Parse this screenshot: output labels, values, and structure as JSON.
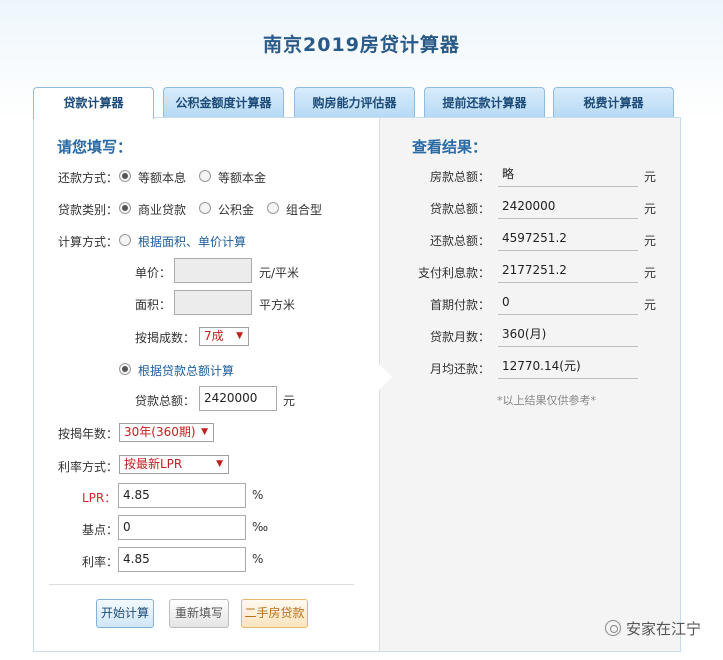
{
  "page": {
    "title": "南京2019房贷计算器"
  },
  "tabs": [
    {
      "label": "贷款计算器",
      "active": true
    },
    {
      "label": "公积金额度计算器"
    },
    {
      "label": "购房能力评估器"
    },
    {
      "label": "提前还款计算器"
    },
    {
      "label": "税费计算器"
    }
  ],
  "form": {
    "heading": "请您填写：",
    "repay_method": {
      "label": "还款方式：",
      "options": [
        "等额本息",
        "等额本金"
      ],
      "selected": "等额本息"
    },
    "loan_type": {
      "label": "贷款类别：",
      "options": [
        "商业贷款",
        "公积金",
        "组合型"
      ],
      "selected": "商业贷款"
    },
    "calc_method": {
      "label": "计算方式：",
      "option_area": "根据面积、单价计算",
      "option_total": "根据贷款总额计算",
      "selected": "根据贷款总额计算"
    },
    "unit_price": {
      "label": "单价：",
      "value": "",
      "unit": "元/平米"
    },
    "area": {
      "label": "面积：",
      "value": "",
      "unit": "平方米"
    },
    "mortgage_ratio": {
      "label": "按揭成数：",
      "value": "7成"
    },
    "loan_total": {
      "label": "贷款总额：",
      "value": "2420000",
      "unit": "元"
    },
    "years": {
      "label": "按揭年数：",
      "value": "30年(360期)"
    },
    "rate_method": {
      "label": "利率方式：",
      "value": "按最新LPR"
    },
    "lpr": {
      "label": "LPR：",
      "value": "4.85",
      "unit": "%"
    },
    "basis_point": {
      "label": "基点：",
      "value": "0",
      "unit": "‰"
    },
    "rate": {
      "label": "利率：",
      "value": "4.85",
      "unit": "%"
    }
  },
  "buttons": {
    "calculate": "开始计算",
    "reset": "重新填写",
    "second_hand": "二手房贷款"
  },
  "results": {
    "heading": "查看结果：",
    "rows": [
      {
        "label": "房款总额：",
        "value": "略",
        "unit": "元"
      },
      {
        "label": "贷款总额：",
        "value": "2420000",
        "unit": "元"
      },
      {
        "label": "还款总额：",
        "value": "4597251.2",
        "unit": "元"
      },
      {
        "label": "支付利息款：",
        "value": "2177251.2",
        "unit": "元"
      },
      {
        "label": "首期付款：",
        "value": "0",
        "unit": "元"
      },
      {
        "label": "贷款月数：",
        "value": "360(月)",
        "unit": ""
      },
      {
        "label": "月均还款：",
        "value": "12770.14(元)",
        "unit": ""
      }
    ],
    "note": "*以上结果仅供参考*"
  },
  "watermark": "安家在江宁"
}
